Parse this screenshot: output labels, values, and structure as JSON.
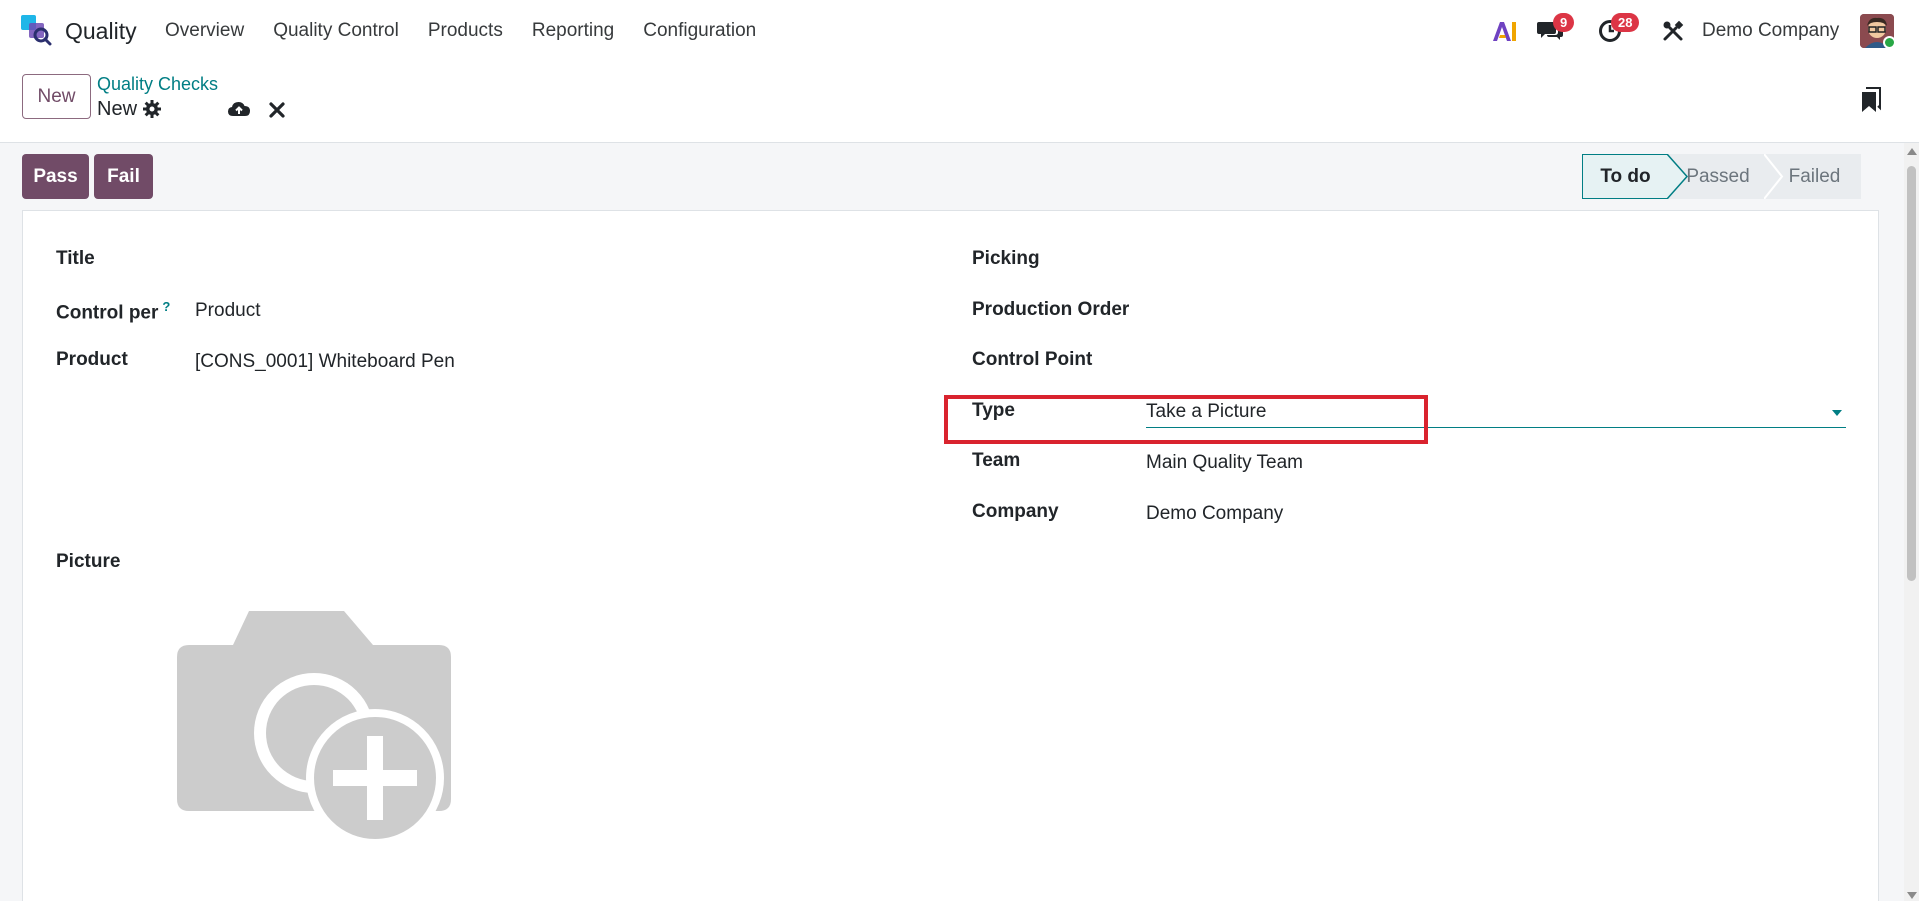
{
  "navbar": {
    "app_name": "Quality",
    "menu": [
      "Overview",
      "Quality Control",
      "Products",
      "Reporting",
      "Configuration"
    ],
    "messages_count": "9",
    "activities_count": "28",
    "company": "Demo Company"
  },
  "control_panel": {
    "new_label": "New",
    "breadcrumb": "Quality Checks",
    "record_name": "New"
  },
  "actions": {
    "pass_label": "Pass",
    "fail_label": "Fail"
  },
  "statusbar": {
    "stages": [
      "To do",
      "Passed",
      "Failed"
    ],
    "active": "To do"
  },
  "form": {
    "left": {
      "title_label": "Title",
      "control_per_label": "Control per",
      "control_per_help": "?",
      "control_per_value": "Product",
      "product_label": "Product",
      "product_value": "[CONS_0001] Whiteboard Pen",
      "picture_label": "Picture"
    },
    "right": {
      "picking_label": "Picking",
      "production_order_label": "Production Order",
      "control_point_label": "Control Point",
      "type_label": "Type",
      "type_value": "Take a Picture",
      "team_label": "Team",
      "team_value": "Main Quality Team",
      "company_label": "Company",
      "company_value": "Demo Company"
    }
  },
  "colors": {
    "brand": "#714b67",
    "accent": "#017e84",
    "highlight": "#d9232e",
    "badge": "#dc3545"
  }
}
